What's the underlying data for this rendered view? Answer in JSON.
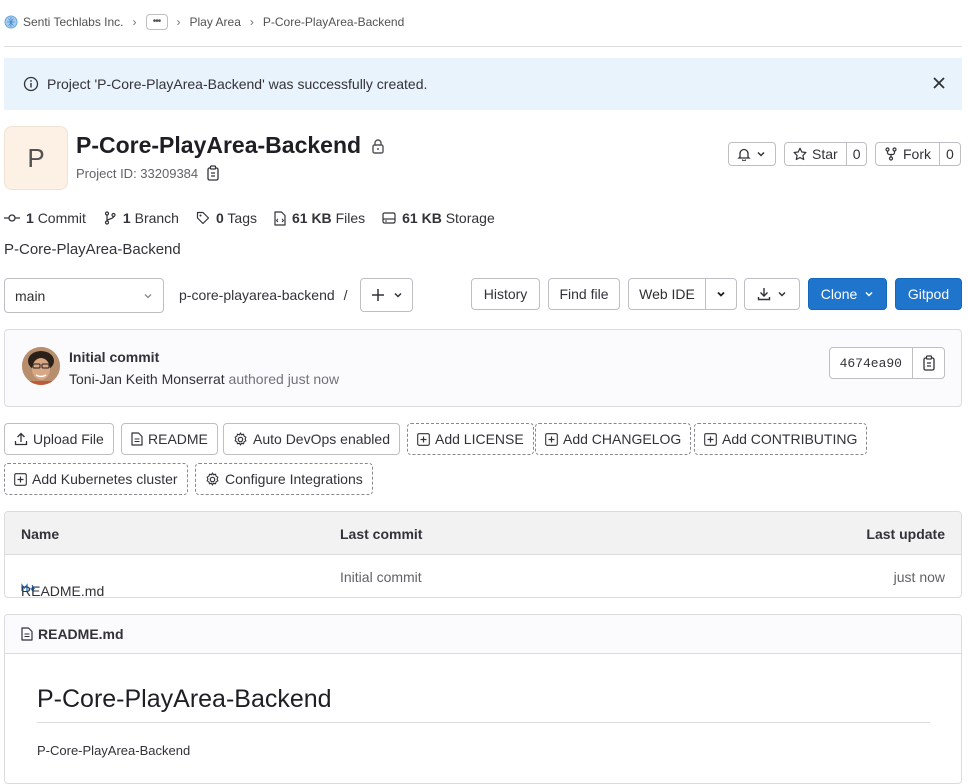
{
  "breadcrumb": {
    "group": "Senti Techlabs Inc.",
    "ellipsis": "•••",
    "subgroup": "Play Area",
    "project": "P-Core-PlayArea-Backend"
  },
  "alert": {
    "message": "Project 'P-Core-PlayArea-Backend' was successfully created."
  },
  "project": {
    "avatar_letter": "P",
    "name": "P-Core-PlayArea-Backend",
    "id_text": "Project ID: 33209384",
    "description": "P-Core-PlayArea-Backend"
  },
  "actions": {
    "star_label": "Star",
    "star_count": "0",
    "fork_label": "Fork",
    "fork_count": "0"
  },
  "stats": {
    "commits_count": "1",
    "commits_label": "Commit",
    "branches_count": "1",
    "branches_label": "Branch",
    "tags_count": "0",
    "tags_label": "Tags",
    "files_size": "61 KB",
    "files_label": "Files",
    "storage_size": "61 KB",
    "storage_label": "Storage"
  },
  "tree": {
    "branch": "main",
    "path": "p-core-playarea-backend",
    "path_sep": "/",
    "history": "History",
    "find_file": "Find file",
    "web_ide": "Web IDE",
    "clone": "Clone",
    "gitpod": "Gitpod"
  },
  "commit": {
    "title": "Initial commit",
    "author": "Toni-Jan Keith Monserrat",
    "meta": "authored just now",
    "sha": "4674ea90"
  },
  "quick_actions": {
    "upload": "Upload File",
    "readme": "README",
    "autodevops": "Auto DevOps enabled",
    "license": "Add LICENSE",
    "changelog": "Add CHANGELOG",
    "contributing": "Add CONTRIBUTING",
    "kubernetes": "Add Kubernetes cluster",
    "integrations": "Configure Integrations"
  },
  "files": {
    "headers": {
      "name": "Name",
      "last_commit": "Last commit",
      "last_update": "Last update"
    },
    "rows": [
      {
        "name": "README.md",
        "last_commit": "Initial commit",
        "last_update": "just now"
      }
    ]
  },
  "readme": {
    "filename": "README.md",
    "heading": "P-Core-PlayArea-Backend",
    "body": "P-Core-PlayArea-Backend"
  },
  "colors": {
    "primary": "#1f75cb",
    "alert_bg": "#e9f3fc",
    "avatar_bg": "#fcf1e4"
  }
}
